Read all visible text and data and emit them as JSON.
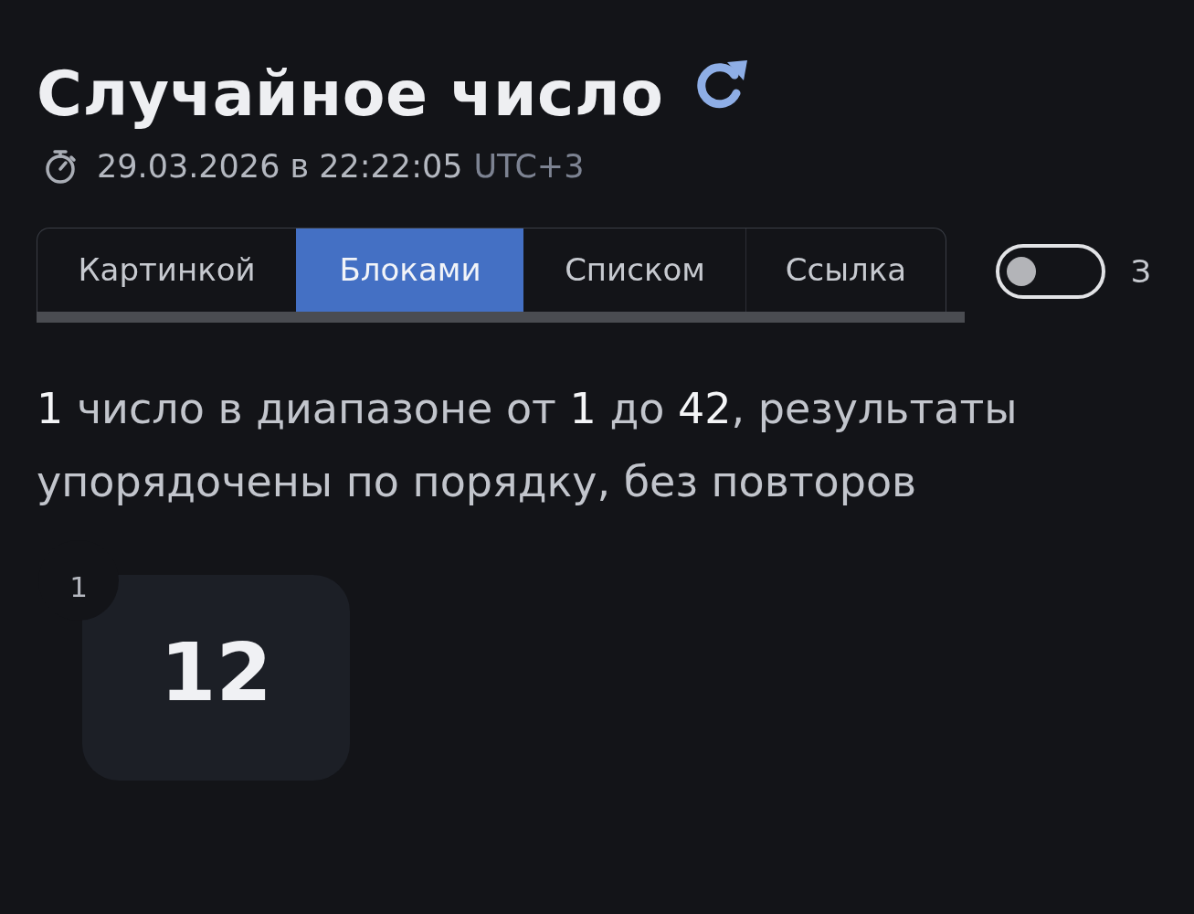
{
  "header": {
    "title": "Случайное число",
    "timestamp": "29.03.2026 в 22:22:05",
    "timezone": "UTC+3"
  },
  "tabs": [
    {
      "label": "Картинкой",
      "selected": false
    },
    {
      "label": "Блоками",
      "selected": true
    },
    {
      "label": "Списком",
      "selected": false
    },
    {
      "label": "Ссылка",
      "selected": false
    }
  ],
  "toggle": {
    "on": false,
    "label": "З"
  },
  "summary": "**1** число в диапазоне от **1** до **42**, результаты упорядочены по порядку, без повторов",
  "results": [
    {
      "index": "1",
      "value": "12"
    }
  ]
}
